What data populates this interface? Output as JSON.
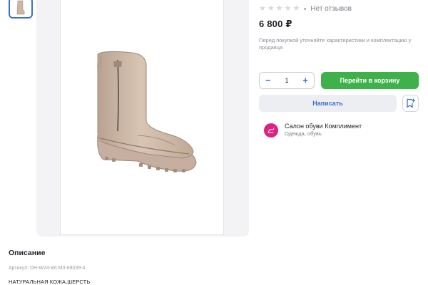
{
  "rating": {
    "stars": 0,
    "max_stars": 5,
    "reviews_label": "Нет отзывов"
  },
  "price": "6 800 ₽",
  "purchase_note": "Перед покупкой уточняйте характеристики и комплектацию у продавца",
  "quantity": {
    "minus": "−",
    "value": "1",
    "plus": "+"
  },
  "buttons": {
    "cart": "Перейти в корзину",
    "write": "Написать"
  },
  "seller": {
    "name": "Салон обуви Комплимент",
    "category": "Одежда, обувь"
  },
  "description": {
    "title": "Описание",
    "sku": "Артикул: DH-W24-WLM3-68039-4",
    "text": "НАТУРАЛЬНАЯ КОЖА,ШЕРСТЬ"
  },
  "colors": {
    "accent_blue": "#3d6fcb",
    "cart_green": "#3fb14b",
    "seller_avatar": "#e02081",
    "boot": "#cdb6a3"
  },
  "icons": {
    "thumbnail": "boot-thumbnail-icon",
    "favorite": "bookmark-plus-icon",
    "seller_logo": "salon-logo-icon"
  }
}
